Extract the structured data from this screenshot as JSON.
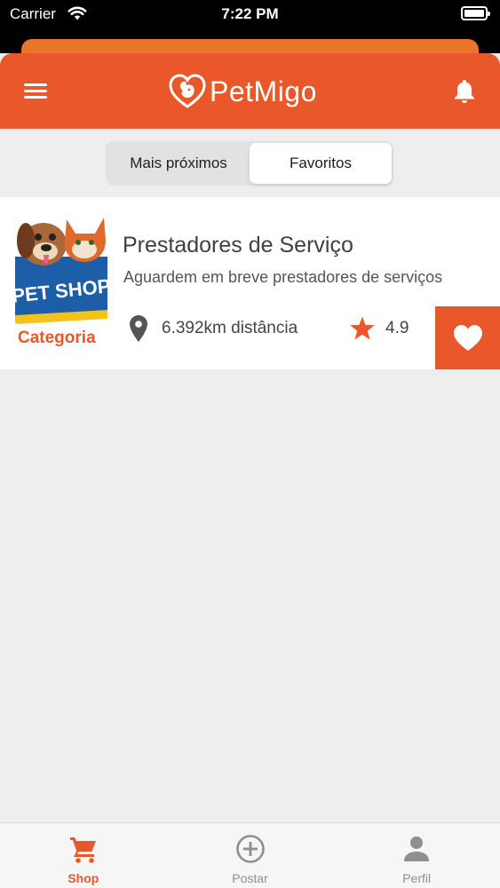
{
  "status_bar": {
    "carrier": "Carrier",
    "time": "7:22 PM"
  },
  "header": {
    "app_name": "PetMigo",
    "brand_color": "#e8582a"
  },
  "segmented_control": {
    "options": [
      "Mais próximos",
      "Favoritos"
    ],
    "selected": "Favoritos"
  },
  "listing": {
    "thumbnail_text": "PET SHOP",
    "title": "Prestadores de Serviço",
    "subtitle": "Aguardem em breve prestadores de serviços",
    "category_label": "Categoria",
    "distance": "6.392km distância",
    "rating": "4.9",
    "favorited": true
  },
  "tab_bar": {
    "tabs": [
      {
        "label": "Shop",
        "icon": "cart-icon",
        "active": true
      },
      {
        "label": "Postar",
        "icon": "plus-circle-icon",
        "active": false
      },
      {
        "label": "Perfil",
        "icon": "person-icon",
        "active": false
      }
    ]
  },
  "colors": {
    "accent": "#e8582a",
    "background": "#efeeef",
    "inactive_tab": "#8e8e93"
  }
}
